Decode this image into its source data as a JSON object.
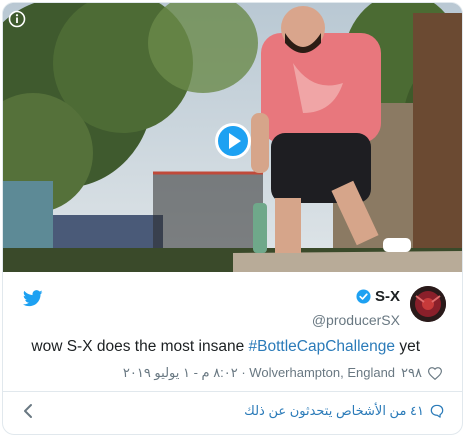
{
  "tweet": {
    "display_name": "S-X",
    "handle": "@producerSX",
    "text_prefix": "wow S-X does the most insane ",
    "hashtag": "#BottleCapChallenge",
    "text_suffix": " yet",
    "likes": "٢٩٨",
    "timestamp": "٨:٠٢ م - ١ يوليو ٢٠١٩ · Wolverhampton, England",
    "conversation": "٤١ من الأشخاص يتحدثون عن ذلك"
  },
  "icons": {
    "info": "info-icon",
    "play": "play-icon",
    "bird": "twitter-bird-icon",
    "verified": "verified-badge-icon",
    "heart": "heart-icon",
    "bubble": "comment-bubble-icon",
    "chevron": "chevron-left-icon"
  },
  "colors": {
    "twitter_blue": "#1da1f2",
    "link": "#2b7bb9",
    "muted": "#697882",
    "border": "#e1e8ed"
  }
}
